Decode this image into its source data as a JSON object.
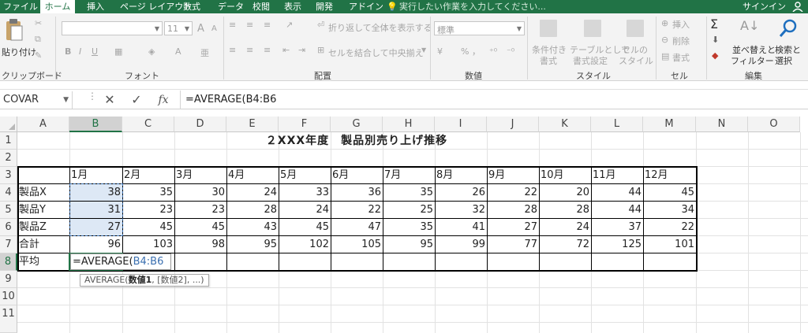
{
  "tabs": [
    "ファイル",
    "ホーム",
    "挿入",
    "ページ レイアウト",
    "数式",
    "データ",
    "校閲",
    "表示",
    "開発",
    "アドイン"
  ],
  "tell_me": "実行したい作業を入力してください...",
  "signin": "サインイン",
  "ribbon": {
    "clipboard": {
      "paste": "貼り付け",
      "label": "クリップボード"
    },
    "font": {
      "name": "",
      "size": "11",
      "label": "フォント",
      "bold": "B",
      "italic": "I",
      "underline": "U",
      "grow": "A",
      "shrink": "A",
      "color": "A"
    },
    "alignment": {
      "wrap": "折り返して全体を表示する",
      "merge": "セルを結合して中央揃え",
      "label": "配置"
    },
    "number": {
      "format": "標準",
      "percent": "%",
      "comma": "，",
      "label": "数値"
    },
    "styles": {
      "conditional": [
        "条件付き",
        "書式"
      ],
      "table": [
        "テーブルとして",
        "書式設定"
      ],
      "cell": [
        "セルの",
        "スタイル"
      ],
      "label": "スタイル"
    },
    "cells": {
      "insert": "挿入",
      "delete": "削除",
      "format": "書式",
      "label": "セル"
    },
    "editing": {
      "sigma": "Σ",
      "sort": [
        "並べ替えと",
        "フィルター"
      ],
      "find": [
        "検索と",
        "選択"
      ],
      "label": "編集"
    }
  },
  "formula_bar": {
    "name_box": "COVAR",
    "formula": "=AVERAGE(B4:B6",
    "cancel": "✕",
    "enter": "✓",
    "fx": "fx"
  },
  "columns": [
    "A",
    "B",
    "C",
    "D",
    "E",
    "F",
    "G",
    "H",
    "I",
    "J",
    "K",
    "L",
    "M",
    "N",
    "O"
  ],
  "rows": [
    "1",
    "2",
    "3",
    "4",
    "5",
    "6",
    "7",
    "8",
    "9",
    "10",
    "11"
  ],
  "sheet": {
    "title": "２XXX年度　製品別売り上げ推移",
    "months": [
      "1月",
      "2月",
      "3月",
      "4月",
      "5月",
      "6月",
      "7月",
      "8月",
      "9月",
      "10月",
      "11月",
      "12月"
    ],
    "products": [
      {
        "name": "製品X",
        "values": [
          38,
          35,
          30,
          24,
          33,
          36,
          35,
          26,
          22,
          20,
          44,
          45
        ]
      },
      {
        "name": "製品Y",
        "values": [
          31,
          23,
          23,
          28,
          24,
          22,
          25,
          32,
          28,
          28,
          44,
          34
        ]
      },
      {
        "name": "製品Z",
        "values": [
          27,
          45,
          45,
          43,
          45,
          47,
          35,
          41,
          27,
          24,
          37,
          22
        ]
      }
    ],
    "total_label": "合計",
    "totals": [
      96,
      103,
      98,
      95,
      102,
      105,
      95,
      99,
      77,
      72,
      125,
      101
    ],
    "avg_label": "平均",
    "editing": {
      "prefix": "=AVERAGE(",
      "ref": "B4:B6"
    },
    "tooltip": {
      "fn": "AVERAGE(",
      "arg1": "数値1",
      "rest": ", [数値2], ...)"
    }
  }
}
